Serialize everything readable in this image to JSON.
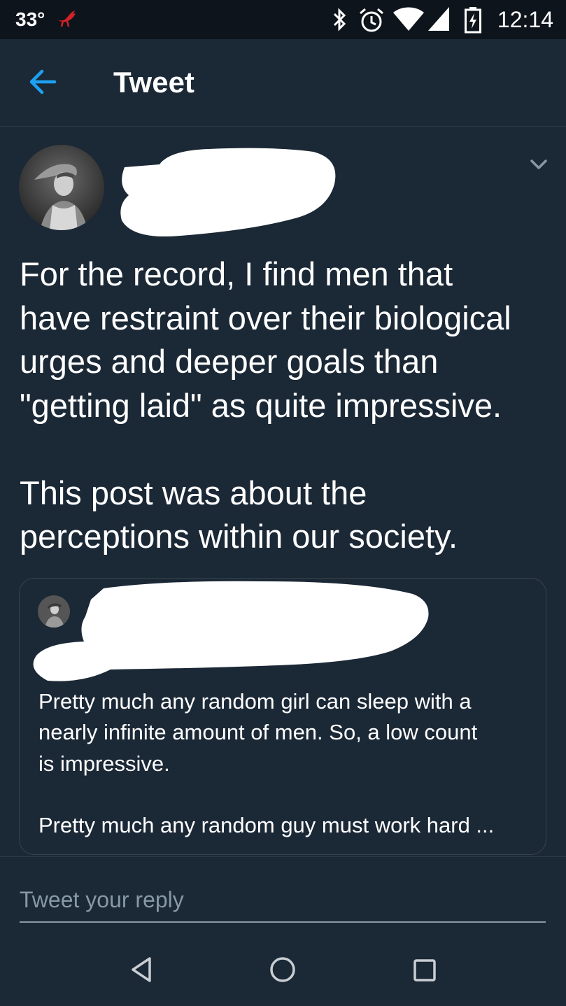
{
  "status_bar": {
    "temperature": "33°",
    "time": "12:14",
    "icons": [
      "notification-bird-icon",
      "bluetooth-icon",
      "alarm-icon",
      "wifi-icon",
      "signal-icon",
      "battery-charging-icon"
    ]
  },
  "header": {
    "title": "Tweet",
    "back_icon": "arrow-left-icon"
  },
  "tweet": {
    "author_name": "",
    "menu_icon": "chevron-down-icon",
    "text": "For the record, I find men that\nhave restraint over their biological\nurges and deeper goals than\n\"getting laid\" as quite impressive.\n\nThis post was about the\nperceptions within our society.",
    "quoted": {
      "author_name": "",
      "text": "Pretty much any random girl can sleep with a\nnearly infinite amount of men.  So, a low count\nis impressive.\n\nPretty much any random guy must work hard ..."
    }
  },
  "reply": {
    "placeholder": "Tweet your reply",
    "value": ""
  },
  "nav": {
    "icons": [
      "back-triangle-icon",
      "home-circle-icon",
      "recents-square-icon"
    ]
  },
  "colors": {
    "background": "#1b2836",
    "accent": "#1da1f2",
    "muted": "#8899a6"
  }
}
